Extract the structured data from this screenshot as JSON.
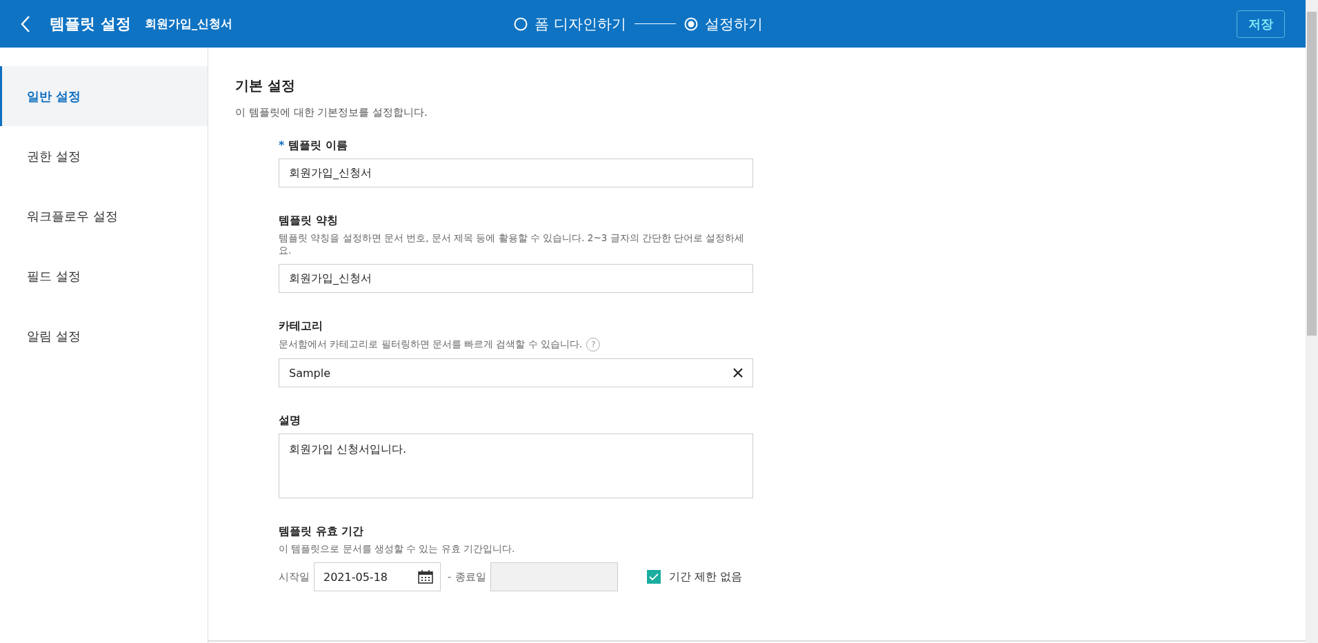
{
  "header": {
    "title": "템플릿 설정",
    "document_name": "회원가입_신청서",
    "steps": [
      {
        "label": "폼 디자인하기",
        "selected": false
      },
      {
        "label": "설정하기",
        "selected": true
      }
    ],
    "save_button": "저장"
  },
  "sidebar": {
    "items": [
      {
        "label": "일반 설정",
        "selected": true
      },
      {
        "label": "권한 설정",
        "selected": false
      },
      {
        "label": "워크플로우 설정",
        "selected": false
      },
      {
        "label": "필드 설정",
        "selected": false
      },
      {
        "label": "알림 설정",
        "selected": false
      }
    ]
  },
  "section": {
    "title": "기본 설정",
    "description": "이 템플릿에 대한 기본정보를 설정합니다."
  },
  "fields": [
    {
      "kind": "text",
      "required_mark": "*",
      "label": "템플릿 이름",
      "value": "회원가입_신청서"
    },
    {
      "kind": "text",
      "label": "템플릿 약칭",
      "hint": "템플릿 약칭을 설정하면 문서 번호, 문서 제목 등에 활용할 수 있습니다. 2~3 글자의 간단한 단어로 설정하세요.",
      "value": "회원가입_신청서"
    },
    {
      "kind": "select",
      "label": "카테고리",
      "hint": "문서함에서 카테고리로 필터링하면 문서를 빠르게 검색할 수 있습니다.",
      "help_icon": "?",
      "value": "Sample"
    },
    {
      "kind": "textarea",
      "label": "설명",
      "value": "회원가입 신청서입니다."
    },
    {
      "kind": "date_range",
      "label": "템플릿 유효 기간",
      "hint": "이 템플릿으로 문서를 생성할 수 있는 유효 기간입니다.",
      "start_label": "시작일",
      "start_value": "2021-05-18",
      "separator": "-",
      "end_label": "종료일",
      "end_disabled": true,
      "no_limit": {
        "label": "기간 제한 없음",
        "checked": true
      }
    }
  ]
}
